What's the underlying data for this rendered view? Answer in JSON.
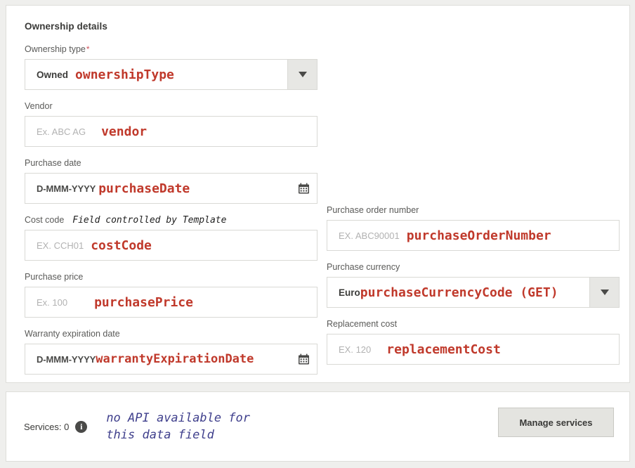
{
  "section": {
    "title": "Ownership details"
  },
  "fields": {
    "ownership_type": {
      "label": "Ownership type",
      "required_mark": "*",
      "value": "Owned",
      "annotation": "ownershipType",
      "dropdown_icon": "chevron-down-icon"
    },
    "vendor": {
      "label": "Vendor",
      "placeholder": "Ex. ABC AG",
      "annotation": "vendor"
    },
    "purchase_date": {
      "label": "Purchase date",
      "mask": "D-MMM-YYYY",
      "annotation": "purchaseDate",
      "calendar_icon": "calendar-icon"
    },
    "cost_code": {
      "label": "Cost code",
      "note": "Field controlled by Template",
      "placeholder": "EX. CCH01",
      "annotation": "costCode"
    },
    "purchase_price": {
      "label": "Purchase price",
      "placeholder": "Ex. 100",
      "annotation": "purchasePrice"
    },
    "warranty_expiration_date": {
      "label": "Warranty expiration date",
      "mask": "D-MMM-YYYY",
      "annotation": "warrantyExpirationDate",
      "calendar_icon": "calendar-icon"
    },
    "purchase_order_number": {
      "label": "Purchase order number",
      "placeholder": "EX. ABC90001",
      "annotation": "purchaseOrderNumber"
    },
    "purchase_currency": {
      "label": "Purchase currency",
      "value": "Euro",
      "annotation": "purchaseCurrencyCode (GET)",
      "dropdown_icon": "chevron-down-icon"
    },
    "replacement_cost": {
      "label": "Replacement cost",
      "placeholder": "EX. 120",
      "annotation": "replacementCost"
    }
  },
  "services": {
    "count_label": "Services: 0",
    "info_icon": "info-icon",
    "info_glyph": "i",
    "annotation": "no API available for\nthis data field",
    "manage_button": "Manage services"
  },
  "colors": {
    "annotation_red": "#c0392b",
    "annotation_blue": "#3f3f8c",
    "required_star": "#d0515a",
    "page_bg": "#efefed",
    "card_bg": "#ffffff",
    "border": "#d9d9d5"
  }
}
